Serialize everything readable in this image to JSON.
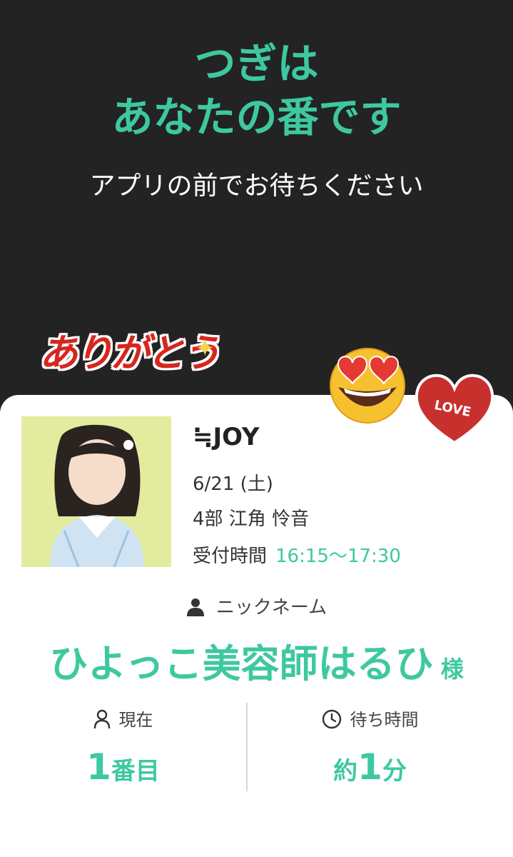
{
  "header": {
    "line1": "つぎは",
    "line2": "あなたの番です",
    "subtitle": "アプリの前でお待ちください"
  },
  "stickers": {
    "arigatou": "ありがとう",
    "love": "LOVE",
    "face": "heart-eyes-face"
  },
  "ticket": {
    "group": "≒JOY",
    "date": "6/21 (土)",
    "part": "4部  江角 怜音",
    "reception_label": "受付時間",
    "reception_time": "16:15〜17:30"
  },
  "nickname": {
    "label": "ニックネーム",
    "value": "ひよっこ美容師はるひ",
    "suffix": "様"
  },
  "status": {
    "current_label": "現在",
    "current_number": "1",
    "current_unit": "番目",
    "wait_label": "待ち時間",
    "wait_prefix": "約",
    "wait_number": "1",
    "wait_unit": "分"
  },
  "colors": {
    "accent": "#3ec8a0",
    "background": "#232323",
    "card": "#ffffff"
  }
}
